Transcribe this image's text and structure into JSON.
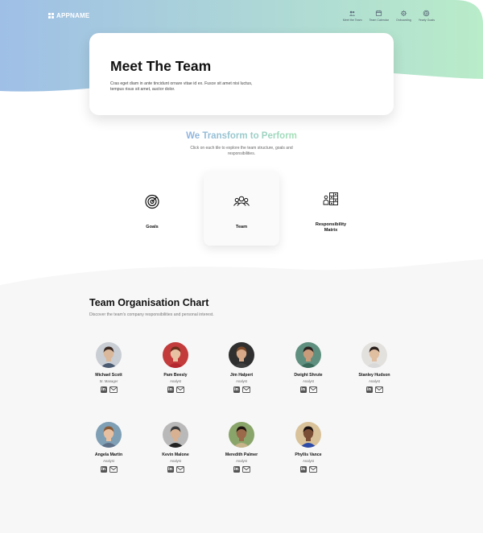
{
  "app": {
    "name": "APPNAME"
  },
  "nav": [
    {
      "label": "Meet the Team",
      "icon": "people-icon"
    },
    {
      "label": "Team Calendar",
      "icon": "calendar-icon"
    },
    {
      "label": "Onboarding",
      "icon": "gear-icon"
    },
    {
      "label": "Yearly Goals",
      "icon": "target-icon"
    }
  ],
  "hero": {
    "title": "Meet The Team",
    "subtitle": "Cras eget diam in ante tincidunt ornare vitae id ex. Fusce sit amet nisi luctus, tempus risus sit amet, auctor dolor."
  },
  "transform": {
    "title": "We Transform to Perform",
    "subtitle": "Click on each tile to explore the team structure, goals and responsibilities."
  },
  "tiles": [
    {
      "label": "Goals",
      "icon": "target-icon",
      "active": false
    },
    {
      "label": "Team",
      "icon": "team-icon",
      "active": true
    },
    {
      "label": "Responsibility Matrix",
      "icon": "matrix-icon",
      "active": false
    }
  ],
  "org": {
    "title": "Team Organisation Chart",
    "subtitle": "Discover the team's company responsibilities and personal interest."
  },
  "members": [
    {
      "name": "Michael Scott",
      "role": "Sr. Manager",
      "skin": "#d9b89c",
      "hair": "#3a2a22",
      "shirt": "#4a5a70",
      "bg": "#c9cdd4"
    },
    {
      "name": "Pam Beesly",
      "role": "Analyst",
      "skin": "#e8c1a3",
      "hair": "#6b2f1a",
      "shirt": "#b5272f",
      "bg": "#c33b3b"
    },
    {
      "name": "Jim Halpert",
      "role": "Analyst",
      "skin": "#d7a988",
      "hair": "#7a4a2a",
      "shirt": "#3f3f3f",
      "bg": "#2f2f2f"
    },
    {
      "name": "Dwight Shrute",
      "role": "Analyst",
      "skin": "#c89b7b",
      "hair": "#2a2220",
      "shirt": "#3a6a5a",
      "bg": "#5f8f7f"
    },
    {
      "name": "Stanley Hudson",
      "role": "Analyst",
      "skin": "#e0bea0",
      "hair": "#2b211c",
      "shirt": "#d9d9d9",
      "bg": "#e3e1de"
    },
    {
      "name": "Angela Martin",
      "role": "Analyst",
      "skin": "#e6c0a0",
      "hair": "#8a5a36",
      "shirt": "#5c6f86",
      "bg": "#7f9fb5"
    },
    {
      "name": "Kevin Malone",
      "role": "Analyst",
      "skin": "#d8b092",
      "hair": "#3a3a3a",
      "shirt": "#222222",
      "bg": "#b9b9b9"
    },
    {
      "name": "Meredith Palmer",
      "role": "Analyst",
      "skin": "#9a6a4a",
      "hair": "#1e1410",
      "shirt": "#c7b48a",
      "bg": "#8aa56a"
    },
    {
      "name": "Phyllis Vance",
      "role": "Analyst",
      "skin": "#7a4e34",
      "hair": "#1a1110",
      "shirt": "#2c4aa8",
      "bg": "#d9c29a"
    }
  ],
  "colors": {
    "hero_gradient_start": "#9fbfe6",
    "hero_gradient_end": "#b9ecc9",
    "transform_gradient_start": "#8fb3df",
    "transform_gradient_end": "#a3e0b5",
    "lower_background": "#f7f7f7"
  }
}
